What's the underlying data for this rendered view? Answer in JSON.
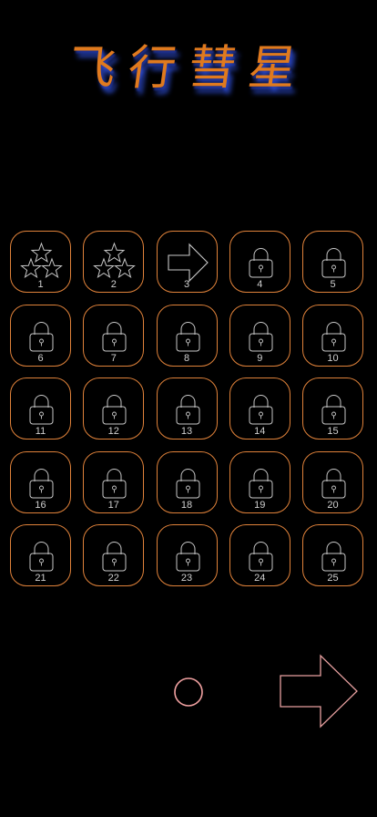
{
  "title": "飞行彗星",
  "levels": [
    {
      "number": "1",
      "state": "stars",
      "icon": "three-stars-icon"
    },
    {
      "number": "2",
      "state": "stars",
      "icon": "three-stars-icon"
    },
    {
      "number": "3",
      "state": "current",
      "icon": "arrow-right-icon"
    },
    {
      "number": "4",
      "state": "locked",
      "icon": "lock-icon"
    },
    {
      "number": "5",
      "state": "locked",
      "icon": "lock-icon"
    },
    {
      "number": "6",
      "state": "locked",
      "icon": "lock-icon"
    },
    {
      "number": "7",
      "state": "locked",
      "icon": "lock-icon"
    },
    {
      "number": "8",
      "state": "locked",
      "icon": "lock-icon"
    },
    {
      "number": "9",
      "state": "locked",
      "icon": "lock-icon"
    },
    {
      "number": "10",
      "state": "locked",
      "icon": "lock-icon"
    },
    {
      "number": "11",
      "state": "locked",
      "icon": "lock-icon"
    },
    {
      "number": "12",
      "state": "locked",
      "icon": "lock-icon"
    },
    {
      "number": "13",
      "state": "locked",
      "icon": "lock-icon"
    },
    {
      "number": "14",
      "state": "locked",
      "icon": "lock-icon"
    },
    {
      "number": "15",
      "state": "locked",
      "icon": "lock-icon"
    },
    {
      "number": "16",
      "state": "locked",
      "icon": "lock-icon"
    },
    {
      "number": "17",
      "state": "locked",
      "icon": "lock-icon"
    },
    {
      "number": "18",
      "state": "locked",
      "icon": "lock-icon"
    },
    {
      "number": "19",
      "state": "locked",
      "icon": "lock-icon"
    },
    {
      "number": "20",
      "state": "locked",
      "icon": "lock-icon"
    },
    {
      "number": "21",
      "state": "locked",
      "icon": "lock-icon"
    },
    {
      "number": "22",
      "state": "locked",
      "icon": "lock-icon"
    },
    {
      "number": "23",
      "state": "locked",
      "icon": "lock-icon"
    },
    {
      "number": "24",
      "state": "locked",
      "icon": "lock-icon"
    },
    {
      "number": "25",
      "state": "locked",
      "icon": "lock-icon"
    }
  ],
  "page_indicator": {
    "icon": "circle-icon",
    "pages": 1
  },
  "next_button": {
    "icon": "arrow-right-icon"
  },
  "colors": {
    "background": "#000000",
    "cell_border": "#e0823a",
    "icon_stroke": "#c8c8c8",
    "title_fill": "#e07a1e",
    "title_shadow": "#2f4fd8",
    "circle_stroke": "#f0a0a0",
    "next_arrow_stroke": "#e8a0a0"
  }
}
